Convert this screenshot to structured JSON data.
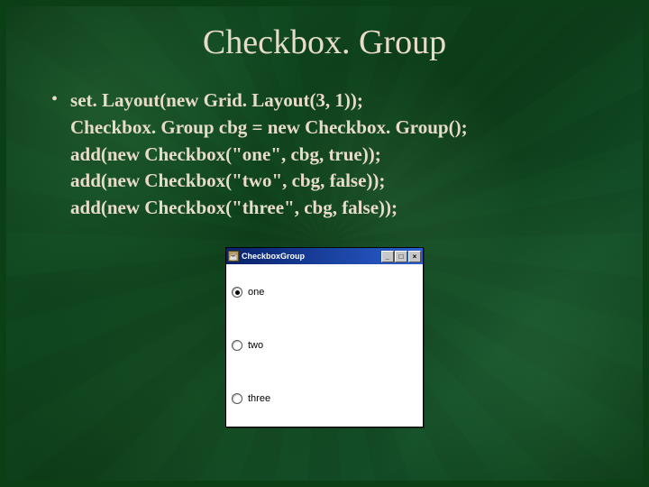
{
  "slide": {
    "title": "Checkbox. Group",
    "bullet_glyph": "•",
    "code": {
      "l1": "set. Layout(new Grid. Layout(3, 1));",
      "l2": "Checkbox. Group cbg = new Checkbox. Group();",
      "l3": "add(new Checkbox(\"one\", cbg, true));",
      "l4": "add(new Checkbox(\"two\", cbg, false));",
      "l5": "add(new Checkbox(\"three\", cbg, false));"
    }
  },
  "window": {
    "title": "CheckboxGroup",
    "icon_glyph": "☕",
    "buttons": {
      "min": "_",
      "max": "□",
      "close": "×"
    },
    "radios": [
      {
        "label": "one",
        "checked": true
      },
      {
        "label": "two",
        "checked": false
      },
      {
        "label": "three",
        "checked": false
      }
    ]
  }
}
